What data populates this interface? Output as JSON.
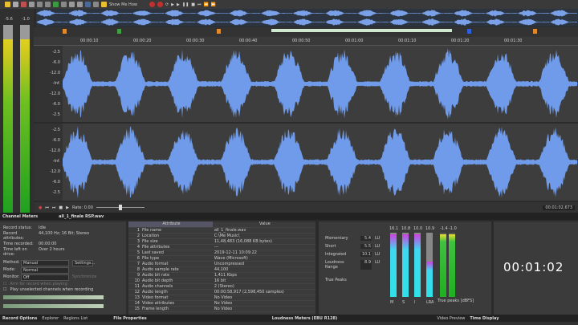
{
  "toolbar": {
    "show_me_how": "Show Me How",
    "icons": [
      "new-icon",
      "open-icon",
      "save-icon",
      "save-as-icon",
      "render-icon",
      "cut-icon",
      "copy-icon",
      "paste-icon",
      "mix-icon",
      "crop-icon",
      "undo-icon",
      "redo-icon",
      "repeat-icon",
      "edit-tool-icon",
      "magnify-tool-icon",
      "pencil-icon",
      "event-tool-icon",
      "record-icon",
      "record-arm-icon",
      "loop-icon",
      "play-all-icon",
      "play-icon",
      "pause-icon",
      "stop-icon",
      "go-start-icon",
      "rewind-icon",
      "forward-icon"
    ]
  },
  "meters": {
    "left_label": "-5.6",
    "right_label": "-1.0",
    "scale": [
      "-3",
      "-6",
      "-9",
      "-12",
      "-15",
      "-18",
      "-21",
      "-24",
      "-27",
      "-30",
      "-33",
      "-36",
      "-39"
    ]
  },
  "waveform": {
    "color": "#6f9bea",
    "ruler": [
      "00:00:10",
      "00:00:20",
      "00:00:30",
      "00:00:40",
      "00:00:50",
      "00:01:00",
      "00:01:10",
      "00:01:20",
      "00:01:30"
    ],
    "scale": [
      "-2.5",
      "-6.0",
      "-12.0",
      "-Inf.",
      "-12.0",
      "-6.0",
      "-2.5"
    ]
  },
  "transport": {
    "rate": "Rate: 0.00",
    "position": "00:01:02,673"
  },
  "tabs_top": {
    "channel_meters": "Channel Meters",
    "file": "all_1_finale RSP.wav"
  },
  "recording": {
    "status_label": "Record status:",
    "status": "Idle",
    "attr_label": "Record attributes:",
    "attr": "44,100 Hz; 16 Bit; Stereo",
    "time_label": "Time recorded:",
    "time": "00:00:00",
    "left_label": "Time left on drive:",
    "left": "Over 2 hours",
    "method_label": "Method:",
    "method": "Manual",
    "settings": "Settings...",
    "mode_label": "Mode:",
    "mode": "Normal",
    "monitor_label": "Monitor:",
    "monitor": "Off",
    "sync": "Synchronize",
    "check1": "Arm for record when playing",
    "check2": "Play unselected channels when recording",
    "scale": [
      "-72",
      "-66",
      "-60",
      "-54",
      "-48",
      "-42",
      "-36",
      "-30",
      "-24",
      "-18",
      "-12",
      "-6"
    ]
  },
  "bottom_tabs": {
    "record_options": "Record Options",
    "explorer": "Explorer",
    "regions_list": "Regions List",
    "file_properties": "File Properties",
    "loudness": "Loudness Meters (EBU R128)",
    "video_preview": "Video Preview",
    "time_display": "Time Display"
  },
  "file_properties": {
    "headers": [
      "Attribute",
      "Value"
    ],
    "rows": [
      [
        "1",
        "File name",
        "all_1_finale.wav"
      ],
      [
        "2",
        "Location",
        "C:\\Me Music\\"
      ],
      [
        "3",
        "File size",
        "11,48,483 (16,088 KB bytes)"
      ],
      [
        "4",
        "File attributes",
        "---"
      ],
      [
        "5",
        "Last saved",
        "2019-12-11 10:09:22"
      ],
      [
        "6",
        "File type",
        "Wave (Microsoft)"
      ],
      [
        "7",
        "Audio format",
        "Uncompressed"
      ],
      [
        "8",
        "Audio sample rate",
        "44,100"
      ],
      [
        "9",
        "Audio bit rate",
        "1,411 Kbps"
      ],
      [
        "10",
        "Audio bit depth",
        "16 bit"
      ],
      [
        "11",
        "Audio channels",
        "2 (Stereo)"
      ],
      [
        "12",
        "Audio length",
        "00:00:58,917 (2,598,450 samples)"
      ],
      [
        "13",
        "Video format",
        "No Video"
      ],
      [
        "14",
        "Video attributes",
        "No Video"
      ],
      [
        "15",
        "Frame length",
        "No Video"
      ]
    ]
  },
  "loudness": {
    "rows": [
      {
        "label": "Momentary",
        "value": "5.4",
        "unit": "LU"
      },
      {
        "label": "Short",
        "value": "5.5",
        "unit": "LU"
      },
      {
        "label": "Integrated",
        "value": "10.1",
        "unit": "LU"
      },
      {
        "label": "Loudness Range",
        "value": "8.9",
        "unit": "LU"
      }
    ],
    "true_peaks": "True Peaks",
    "meters": [
      {
        "top": "16.1",
        "bottom": "M",
        "level": 0.98
      },
      {
        "top": "10.8",
        "bottom": "S",
        "level": 0.97
      },
      {
        "top": "10.0",
        "bottom": "I",
        "level": 0.97
      },
      {
        "top": "10.9",
        "bottom": "LRA",
        "level": 0.55
      }
    ],
    "peaks": [
      {
        "top": "-1.4",
        "level": 0.98
      },
      {
        "top": "-1.0",
        "level": 0.98
      }
    ],
    "peaks_label": "True peaks [dBFS]"
  },
  "time_display": {
    "time": "00:01:02"
  }
}
